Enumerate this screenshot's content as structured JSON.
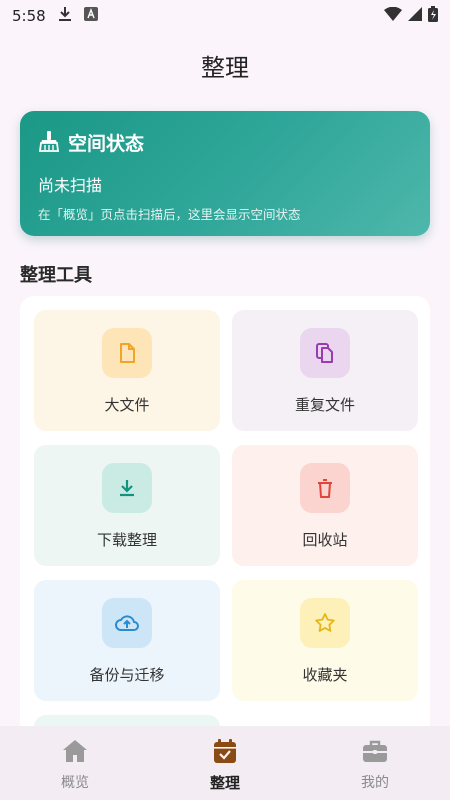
{
  "status_bar": {
    "time": "5:58",
    "icons": [
      "download-icon",
      "a-letter-icon",
      "wifi-icon",
      "signal-icon",
      "battery-icon"
    ]
  },
  "header": {
    "title": "整理"
  },
  "space_card": {
    "icon": "broom-icon",
    "title": "空间状态",
    "status": "尚未扫描",
    "description": "在「概览」页点击扫描后，这里会显示空间状态"
  },
  "tools_section": {
    "title": "整理工具",
    "items": [
      {
        "label": "大文件",
        "icon": "file-icon",
        "bg": "#fdf5e6",
        "icon_bg": "#fde5b8",
        "icon_color": "#f2a32a"
      },
      {
        "label": "重复文件",
        "icon": "copy-icon",
        "bg": "#f5eff6",
        "icon_bg": "#ead7ef",
        "icon_color": "#9a3bb0"
      },
      {
        "label": "下载整理",
        "icon": "download-icon",
        "bg": "#edf6f3",
        "icon_bg": "#c9ebe4",
        "icon_color": "#12937f"
      },
      {
        "label": "回收站",
        "icon": "trash-icon",
        "bg": "#fdf0ed",
        "icon_bg": "#fbd4cf",
        "icon_color": "#e0443a"
      },
      {
        "label": "备份与迁移",
        "icon": "cloud-upload-icon",
        "bg": "#ecf5fc",
        "icon_bg": "#cce6f8",
        "icon_color": "#2a8bd0"
      },
      {
        "label": "收藏夹",
        "icon": "star-icon",
        "bg": "#fefbe8",
        "icon_bg": "#fdf0b8",
        "icon_color": "#e6b618"
      }
    ]
  },
  "bottom_nav": {
    "items": [
      {
        "label": "概览",
        "icon": "home-icon",
        "active": false
      },
      {
        "label": "整理",
        "icon": "calendar-check-icon",
        "active": true
      },
      {
        "label": "我的",
        "icon": "briefcase-icon",
        "active": false
      }
    ]
  }
}
